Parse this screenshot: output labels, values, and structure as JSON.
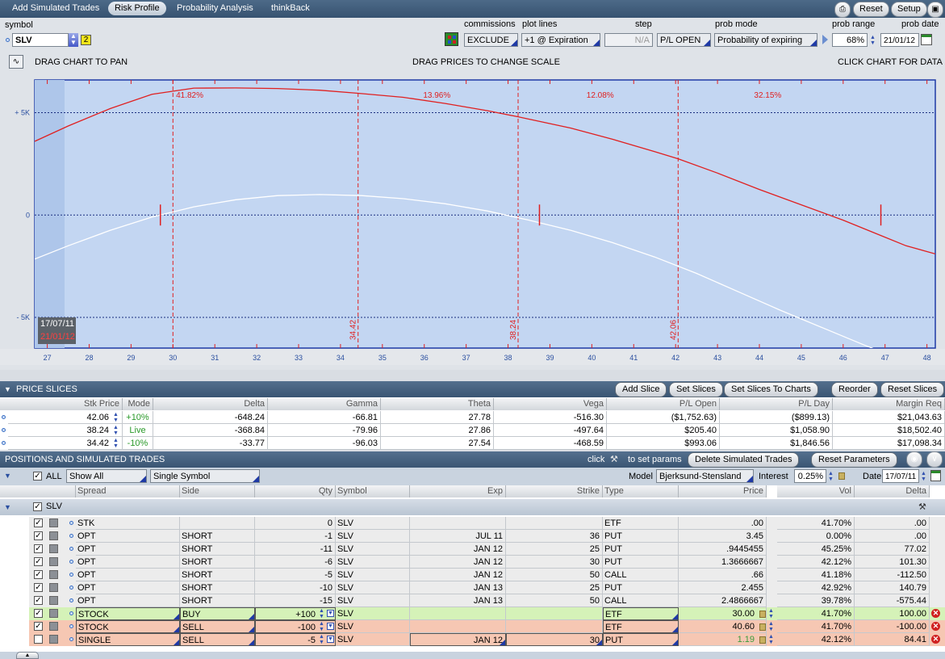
{
  "nav": {
    "tabs": [
      "Add Simulated Trades",
      "Risk Profile",
      "Probability Analysis",
      "thinkBack"
    ],
    "active_index": 1,
    "reset_label": "Reset",
    "setup_label": "Setup"
  },
  "controls": {
    "symbol_label": "symbol",
    "symbol_value": "SLV",
    "symbol_badge": "2",
    "commissions_label": "commissions",
    "commissions_value": "EXCLUDE",
    "plot_lines_label": "plot lines",
    "plot_lines_value": "+1 @ Expiration",
    "step_label": "step",
    "step_value": "N/A",
    "pl_mode_value": "P/L OPEN",
    "prob_mode_label": "prob mode",
    "prob_mode_value": "Probability of expiring",
    "prob_range_label": "prob range",
    "prob_range_value": "68%",
    "prob_date_label": "prob date",
    "prob_date_value": "21/01/12"
  },
  "chart_header": {
    "left": "DRAG CHART TO PAN",
    "center": "DRAG PRICES TO CHANGE SCALE",
    "right": "CLICK CHART FOR DATA"
  },
  "chart_data": {
    "type": "line",
    "xlim": [
      26.7,
      48.2
    ],
    "ylim": [
      -6500,
      6600
    ],
    "x_ticks": [
      27,
      28,
      29,
      30,
      31,
      32,
      33,
      34,
      35,
      36,
      37,
      38,
      39,
      40,
      41,
      42,
      43,
      44,
      45,
      46,
      47,
      48
    ],
    "y_ticks": [
      {
        "value": 5000,
        "label": "+ 5K"
      },
      {
        "value": 0,
        "label": "0"
      },
      {
        "value": -5000,
        "label": "- 5K"
      }
    ],
    "series": [
      {
        "name": "21/01/12",
        "color": "#e02020",
        "x": [
          26.7,
          27.5,
          28.5,
          29.5,
          30.5,
          31.5,
          32.5,
          33.5,
          34.42,
          35.5,
          36.5,
          37.5,
          38.24,
          39.5,
          40.5,
          41.5,
          42.06,
          43,
          44,
          45,
          46,
          46.9,
          47.5,
          48.2
        ],
        "y": [
          3600,
          4350,
          5200,
          5900,
          6200,
          6210,
          6180,
          6100,
          5950,
          5750,
          5450,
          5100,
          4800,
          4250,
          3700,
          3100,
          2750,
          2050,
          1250,
          500,
          -250,
          -1000,
          -1500,
          -1900
        ]
      },
      {
        "name": "17/07/11",
        "color": "#ffffff",
        "x": [
          26.7,
          27.5,
          28.5,
          29.5,
          30.5,
          31.5,
          32.5,
          33.5,
          34.5,
          35.5,
          36.5,
          37.5,
          38.5,
          39.5,
          40.5,
          41.5,
          42.5,
          43.5,
          44.5,
          45.5,
          46.5,
          47.5,
          48.2
        ],
        "y": [
          -2150,
          -1500,
          -750,
          -100,
          400,
          750,
          950,
          1000,
          950,
          800,
          550,
          200,
          -250,
          -750,
          -1350,
          -2050,
          -2850,
          -3750,
          -4650,
          -5500,
          -6350,
          -7150,
          -7650
        ]
      }
    ],
    "slices": [
      {
        "price": 34.42,
        "label": "34.42"
      },
      {
        "price": 38.24,
        "label": "38.24"
      },
      {
        "price": 42.06,
        "label": "42.06"
      }
    ],
    "prob_labels": [
      {
        "x": 30.4,
        "text": "41.82%"
      },
      {
        "x": 36.3,
        "text": "13.96%"
      },
      {
        "x": 40.2,
        "text": "12.08%"
      },
      {
        "x": 44.2,
        "text": "32.15%"
      }
    ],
    "breakevens": [
      29.7,
      38.75,
      46.9
    ],
    "legend": [
      "17/07/11",
      "21/01/12"
    ],
    "grid": true
  },
  "price_slices": {
    "title": "PRICE SLICES",
    "buttons": [
      "Add Slice",
      "Set Slices",
      "Set Slices To Charts",
      "Reorder",
      "Reset Slices"
    ],
    "columns": [
      "Stk Price",
      "Mode",
      "Delta",
      "Gamma",
      "Theta",
      "Vega",
      "P/L Open",
      "P/L Day",
      "Margin Req"
    ],
    "rows": [
      {
        "price": "42.06",
        "mode": "+10%",
        "delta": "-648.24",
        "gamma": "-66.81",
        "theta": "27.78",
        "vega": "-516.30",
        "pl_open": "($1,752.63)",
        "pl_day": "($899.13)",
        "margin": "$21,043.63"
      },
      {
        "price": "38.24",
        "mode": "Live",
        "delta": "-368.84",
        "gamma": "-79.96",
        "theta": "27.86",
        "vega": "-497.64",
        "pl_open": "$205.40",
        "pl_day": "$1,058.90",
        "margin": "$18,502.40"
      },
      {
        "price": "34.42",
        "mode": "-10%",
        "delta": "-33.77",
        "gamma": "-96.03",
        "theta": "27.54",
        "vega": "-468.59",
        "pl_open": "$993.06",
        "pl_day": "$1,846.56",
        "margin": "$17,098.34"
      }
    ]
  },
  "positions": {
    "title": "POSITIONS AND SIMULATED TRADES",
    "click_text": "click",
    "set_params_text": "to set params",
    "delete_button": "Delete Simulated Trades",
    "reset_params_button": "Reset Parameters",
    "all_label": "ALL",
    "show_value": "Show All",
    "symbol_mode_value": "Single Symbol",
    "model_label": "Model",
    "model_value": "Bjerksund-Stensland",
    "interest_label": "Interest",
    "interest_value": "0.25%",
    "date_label": "Date",
    "date_value": "17/07/11",
    "columns": [
      "Spread",
      "Side",
      "Qty",
      "Symbol",
      "Exp",
      "Strike",
      "Type",
      "Price",
      "Vol",
      "Delta"
    ],
    "group_label": "SLV",
    "rows": [
      {
        "spread": "STK",
        "side": "",
        "qty": "0",
        "symbol": "SLV",
        "exp": "",
        "strike": "",
        "type": "ETF",
        "price": ".00",
        "vol": "41.70%",
        "delta": ".00",
        "kind": "pos"
      },
      {
        "spread": "OPT",
        "side": "SHORT",
        "qty": "-1",
        "symbol": "SLV",
        "exp": "JUL 11",
        "strike": "36",
        "type": "PUT",
        "price": "3.45",
        "vol": "0.00%",
        "delta": ".00",
        "kind": "pos"
      },
      {
        "spread": "OPT",
        "side": "SHORT",
        "qty": "-11",
        "symbol": "SLV",
        "exp": "JAN 12",
        "strike": "25",
        "type": "PUT",
        "price": ".9445455",
        "vol": "45.25%",
        "delta": "77.02",
        "kind": "pos"
      },
      {
        "spread": "OPT",
        "side": "SHORT",
        "qty": "-6",
        "symbol": "SLV",
        "exp": "JAN 12",
        "strike": "30",
        "type": "PUT",
        "price": "1.3666667",
        "vol": "42.12%",
        "delta": "101.30",
        "kind": "pos"
      },
      {
        "spread": "OPT",
        "side": "SHORT",
        "qty": "-5",
        "symbol": "SLV",
        "exp": "JAN 12",
        "strike": "50",
        "type": "CALL",
        "price": ".66",
        "vol": "41.18%",
        "delta": "-112.50",
        "kind": "pos"
      },
      {
        "spread": "OPT",
        "side": "SHORT",
        "qty": "-10",
        "symbol": "SLV",
        "exp": "JAN 13",
        "strike": "25",
        "type": "PUT",
        "price": "2.455",
        "vol": "42.92%",
        "delta": "140.79",
        "kind": "pos"
      },
      {
        "spread": "OPT",
        "side": "SHORT",
        "qty": "-15",
        "symbol": "SLV",
        "exp": "JAN 13",
        "strike": "50",
        "type": "CALL",
        "price": "2.4866667",
        "vol": "39.78%",
        "delta": "-575.44",
        "kind": "pos"
      },
      {
        "spread": "STOCK",
        "side": "BUY",
        "qty": "+100",
        "symbol": "SLV",
        "exp": "",
        "strike": "",
        "type": "ETF",
        "price": "30.00",
        "vol": "41.70%",
        "delta": "100.00",
        "kind": "buy"
      },
      {
        "spread": "STOCK",
        "side": "SELL",
        "qty": "-100",
        "symbol": "SLV",
        "exp": "",
        "strike": "",
        "type": "ETF",
        "price": "40.60",
        "vol": "41.70%",
        "delta": "-100.00",
        "kind": "sell"
      },
      {
        "spread": "SINGLE",
        "side": "SELL",
        "qty": "-5",
        "symbol": "SLV",
        "exp": "JAN 12",
        "strike": "30",
        "type": "PUT",
        "price": "1.19",
        "vol": "42.12%",
        "delta": "84.41",
        "kind": "sell2"
      }
    ]
  },
  "colors": {
    "accent": "#3a5573",
    "plot_bg": "#c3d6f2",
    "expiration_line": "#e02020",
    "today_line": "#ffffff",
    "buy_row": "#d5f2b8",
    "sell_row": "#f6c7b3"
  }
}
